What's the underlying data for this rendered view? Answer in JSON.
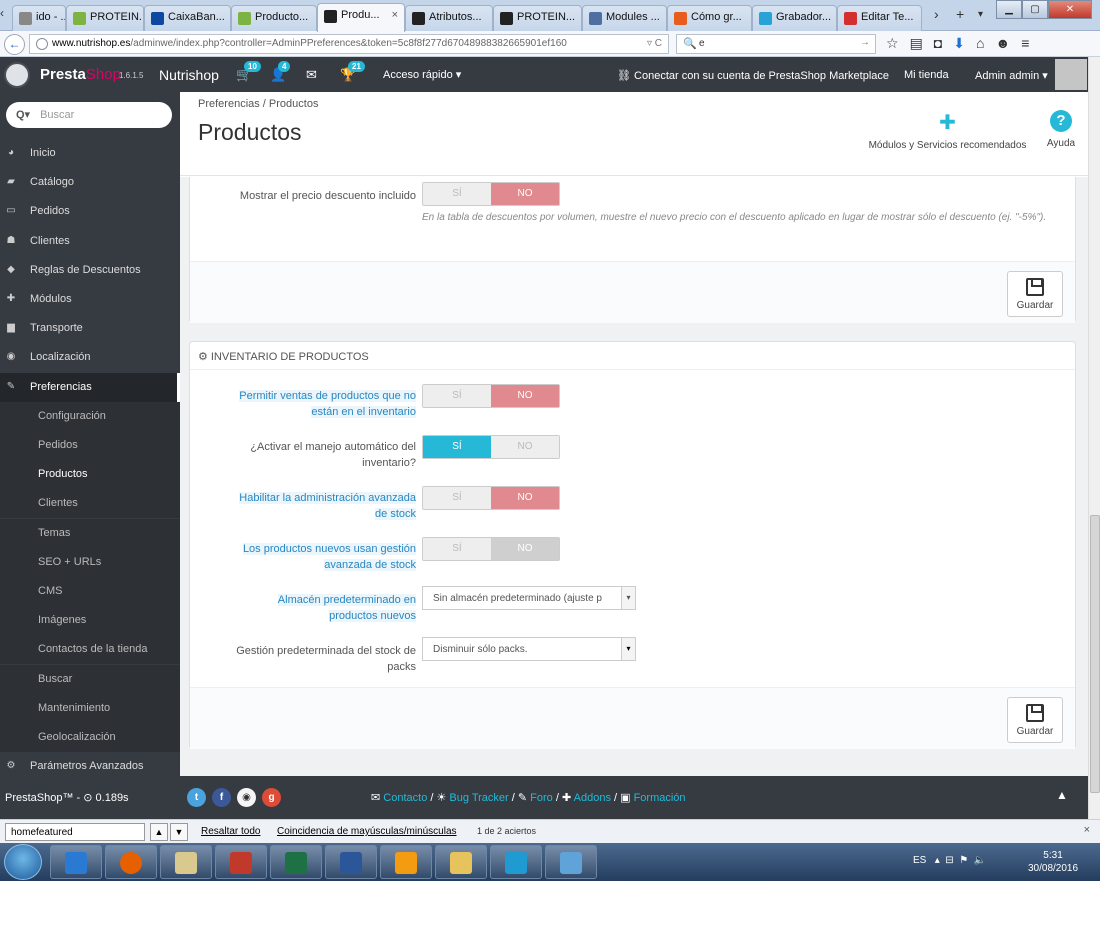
{
  "browser": {
    "tabs": [
      {
        "label": "ido - ...",
        "color": "#888888"
      },
      {
        "label": "PROTEIN...",
        "color": "#7cb342"
      },
      {
        "label": "CaixaBan...",
        "color": "#0d47a1"
      },
      {
        "label": "Producto...",
        "color": "#7cb342"
      },
      {
        "label": "Produ...",
        "color": "#222222",
        "active": true,
        "close": "×"
      },
      {
        "label": "Atributos...",
        "color": "#222222"
      },
      {
        "label": "PROTEIN...",
        "color": "#222222"
      },
      {
        "label": "Modules ...",
        "color": "#4e6fa0"
      },
      {
        "label": "Cómo gr...",
        "color": "#e85d1e"
      },
      {
        "label": "Grabador...",
        "color": "#29a3d6"
      },
      {
        "label": "Editar Te...",
        "color": "#d32f2f"
      }
    ],
    "url_host": "www.nutrishop.es",
    "url_path": "/adminwe/index.php?controller=AdminPPreferences&token=5c8f8f277d67048988382665901ef160",
    "search_value": "e"
  },
  "header": {
    "brand_presta": "Presta",
    "brand_shop": "Shop",
    "version": "1.6.1.5",
    "shop_name": "Nutrishop",
    "badges": [
      "10",
      "4",
      "21"
    ],
    "quick_access": "Acceso rápido ▾",
    "marketplace": "Conectar con su cuenta de PrestaShop Marketplace",
    "my_shop": "Mi tienda",
    "admin": "Admin admin ▾"
  },
  "sidebar": {
    "search_placeholder": "Buscar",
    "items": [
      {
        "label": "Inicio",
        "icon": "dashboard-icon"
      },
      {
        "label": "Catálogo",
        "icon": "catalog-icon"
      },
      {
        "label": "Pedidos",
        "icon": "orders-icon"
      },
      {
        "label": "Clientes",
        "icon": "customers-icon"
      },
      {
        "label": "Reglas de Descuentos",
        "icon": "discount-icon"
      },
      {
        "label": "Módulos",
        "icon": "modules-icon"
      },
      {
        "label": "Transporte",
        "icon": "truck-icon"
      },
      {
        "label": "Localización",
        "icon": "globe-icon"
      },
      {
        "label": "Preferencias",
        "icon": "wrench-icon"
      }
    ],
    "subitems": [
      "Configuración",
      "Pedidos",
      "Productos",
      "Clientes",
      "Temas",
      "SEO + URLs",
      "CMS",
      "Imágenes",
      "Contactos de la tienda",
      "Buscar",
      "Mantenimiento",
      "Geolocalización"
    ],
    "advanced": "Parámetros Avanzados"
  },
  "page": {
    "breadcrumb": "Preferencias  /  Productos",
    "title": "Productos",
    "modules_label": "Módulos y Servicios recomendados",
    "help_label": "Ayuda"
  },
  "panel1": {
    "label": "Mostrar el precio descuento incluido",
    "si": "SÍ",
    "no": "NO",
    "help": "En la tabla de descuentos por volumen, muestre el nuevo precio con el descuento aplicado en lugar de mostrar sólo el descuento (ej. \"-5%\").",
    "save": "Guardar"
  },
  "panel2": {
    "title": "INVENTARIO DE PRODUCTOS",
    "fields": [
      {
        "label1": "Permitir ventas de productos que no",
        "label2": "están en el inventario"
      },
      {
        "label1": "¿Activar el manejo automático del",
        "label2": "inventario?"
      },
      {
        "label1": "Habilitar la administración avanzada",
        "label2": "de stock"
      },
      {
        "label1": "Los productos nuevos usan gestión",
        "label2": "avanzada de stock"
      },
      {
        "label1": "Almacén predeterminado en",
        "label2": "productos nuevos"
      },
      {
        "label1": "Gestión predeterminada del stock de",
        "label2": "packs"
      }
    ],
    "si": "SÍ",
    "no": "NO",
    "warehouse_value": "Sin almacén predeterminado (ajuste p",
    "packs_value": "Disminuir sólo packs.",
    "save": "Guardar"
  },
  "footer": {
    "version": "PrestaShop™ - ⊙ 0.189s",
    "links": [
      {
        "icon": "✉",
        "label": "Contacto"
      },
      {
        "icon": "☀",
        "label": "Bug Tracker"
      },
      {
        "icon": "✎",
        "label": "Foro"
      },
      {
        "icon": "✚",
        "label": "Addons"
      },
      {
        "icon": "▣",
        "label": "Formación"
      }
    ]
  },
  "findbar": {
    "value": "homefeatured",
    "highlight_all": "Resaltar todo",
    "match_case": "Coincidencia de mayúsculas/minúsculas",
    "status": "1 de 2 aciertos"
  },
  "taskbar": {
    "lang": "ES",
    "time": "5:31",
    "date": "30/08/2016"
  }
}
